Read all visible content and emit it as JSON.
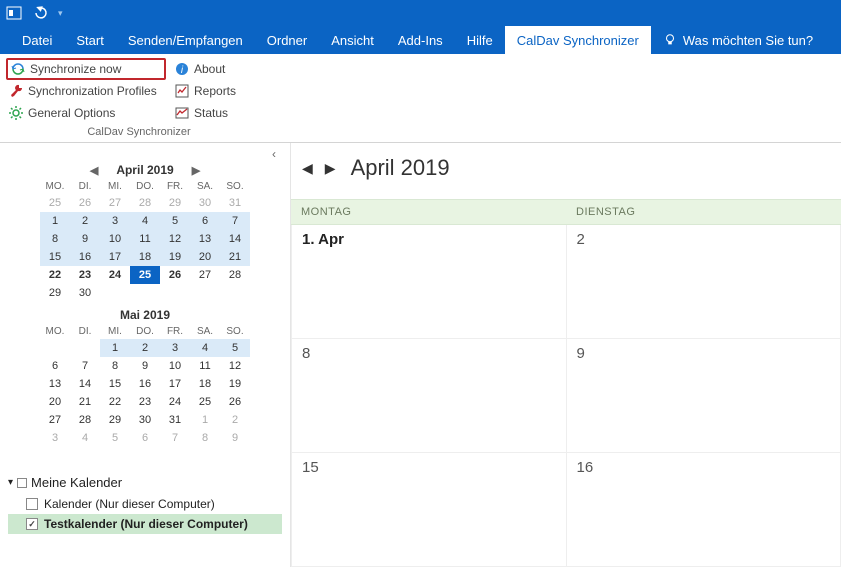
{
  "titlebar": {
    "app_menu": "▾"
  },
  "tabs": {
    "items": [
      {
        "label": "Datei"
      },
      {
        "label": "Start"
      },
      {
        "label": "Senden/Empfangen"
      },
      {
        "label": "Ordner"
      },
      {
        "label": "Ansicht"
      },
      {
        "label": "Add-Ins"
      },
      {
        "label": "Hilfe"
      },
      {
        "label": "CalDav Synchronizer"
      }
    ],
    "tell_me": "Was möchten Sie tun?"
  },
  "ribbon": {
    "sync_now": "Synchronize now",
    "sync_profiles": "Synchronization Profiles",
    "general_options": "General Options",
    "about": "About",
    "reports": "Reports",
    "status": "Status",
    "group_label": "CalDav Synchronizer"
  },
  "mini_calendars": [
    {
      "title": "April 2019",
      "headers": [
        "MO.",
        "DI.",
        "MI.",
        "DO.",
        "FR.",
        "SA.",
        "SO."
      ],
      "rows": [
        [
          {
            "v": "25",
            "o": 1
          },
          {
            "v": "26",
            "o": 1
          },
          {
            "v": "27",
            "o": 1
          },
          {
            "v": "28",
            "o": 1
          },
          {
            "v": "29",
            "o": 1
          },
          {
            "v": "30",
            "o": 1
          },
          {
            "v": "31",
            "o": 1
          }
        ],
        [
          {
            "v": "1",
            "m": 1
          },
          {
            "v": "2",
            "m": 1
          },
          {
            "v": "3",
            "m": 1
          },
          {
            "v": "4",
            "m": 1
          },
          {
            "v": "5",
            "m": 1
          },
          {
            "v": "6",
            "m": 1
          },
          {
            "v": "7",
            "m": 1
          }
        ],
        [
          {
            "v": "8",
            "m": 1
          },
          {
            "v": "9",
            "m": 1
          },
          {
            "v": "10",
            "m": 1
          },
          {
            "v": "11",
            "m": 1
          },
          {
            "v": "12",
            "m": 1
          },
          {
            "v": "13",
            "m": 1
          },
          {
            "v": "14",
            "m": 1
          }
        ],
        [
          {
            "v": "15",
            "m": 1
          },
          {
            "v": "16",
            "m": 1
          },
          {
            "v": "17",
            "m": 1
          },
          {
            "v": "18",
            "m": 1
          },
          {
            "v": "19",
            "m": 1
          },
          {
            "v": "20",
            "m": 1
          },
          {
            "v": "21",
            "m": 1
          }
        ],
        [
          {
            "v": "22",
            "b": 1
          },
          {
            "v": "23",
            "b": 1
          },
          {
            "v": "24",
            "b": 1
          },
          {
            "v": "25",
            "t": 1
          },
          {
            "v": "26",
            "b": 1
          },
          {
            "v": "27"
          },
          {
            "v": "28"
          }
        ],
        [
          {
            "v": "29"
          },
          {
            "v": "30"
          },
          {
            "v": ""
          },
          {
            "v": ""
          },
          {
            "v": ""
          },
          {
            "v": ""
          },
          {
            "v": ""
          }
        ]
      ],
      "nav": true
    },
    {
      "title": "Mai 2019",
      "headers": [
        "MO.",
        "DI.",
        "MI.",
        "DO.",
        "FR.",
        "SA.",
        "SO."
      ],
      "rows": [
        [
          {
            "v": ""
          },
          {
            "v": ""
          },
          {
            "v": "1",
            "h": 1
          },
          {
            "v": "2",
            "h": 1
          },
          {
            "v": "3",
            "h": 1
          },
          {
            "v": "4",
            "h": 1
          },
          {
            "v": "5",
            "h": 1
          }
        ],
        [
          {
            "v": "6"
          },
          {
            "v": "7"
          },
          {
            "v": "8"
          },
          {
            "v": "9"
          },
          {
            "v": "10"
          },
          {
            "v": "11"
          },
          {
            "v": "12"
          }
        ],
        [
          {
            "v": "13"
          },
          {
            "v": "14"
          },
          {
            "v": "15"
          },
          {
            "v": "16"
          },
          {
            "v": "17"
          },
          {
            "v": "18"
          },
          {
            "v": "19"
          }
        ],
        [
          {
            "v": "20"
          },
          {
            "v": "21"
          },
          {
            "v": "22"
          },
          {
            "v": "23"
          },
          {
            "v": "24"
          },
          {
            "v": "25"
          },
          {
            "v": "26"
          }
        ],
        [
          {
            "v": "27"
          },
          {
            "v": "28"
          },
          {
            "v": "29"
          },
          {
            "v": "30"
          },
          {
            "v": "31"
          },
          {
            "v": "1",
            "o": 1
          },
          {
            "v": "2",
            "o": 1
          }
        ],
        [
          {
            "v": "3",
            "o": 1
          },
          {
            "v": "4",
            "o": 1
          },
          {
            "v": "5",
            "o": 1
          },
          {
            "v": "6",
            "o": 1
          },
          {
            "v": "7",
            "o": 1
          },
          {
            "v": "8",
            "o": 1
          },
          {
            "v": "9",
            "o": 1
          }
        ]
      ],
      "nav": false
    }
  ],
  "calendars_section": {
    "title": "Meine Kalender",
    "items": [
      {
        "label": "Kalender (Nur dieser Computer)",
        "checked": false,
        "selected": false
      },
      {
        "label": "Testkalender (Nur dieser Computer)",
        "checked": true,
        "selected": true
      }
    ]
  },
  "calendar_view": {
    "title": "April 2019",
    "columns": [
      "MONTAG",
      "DIENSTAG"
    ],
    "weeks": [
      [
        {
          "label": "1. Apr",
          "first": true
        },
        {
          "label": "2"
        }
      ],
      [
        {
          "label": "8"
        },
        {
          "label": "9"
        }
      ],
      [
        {
          "label": "15"
        },
        {
          "label": "16"
        }
      ]
    ]
  }
}
